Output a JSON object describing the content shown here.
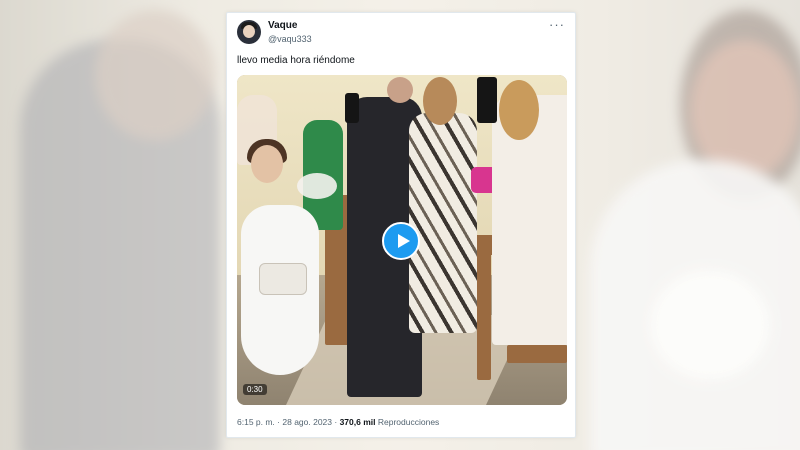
{
  "tweet": {
    "author_name": "Vaque",
    "author_handle": "@vaqu333",
    "text": "llevo media hora riéndome",
    "more_icon": "more-horizontal-icon",
    "media": {
      "type": "video",
      "duration": "0:30",
      "play_icon": "play-icon",
      "accent_color": "#1d9bf0"
    },
    "meta": {
      "time": "6:15 p. m.",
      "separator1": " · ",
      "date": "28 ago. 2023",
      "separator2": " · ",
      "views_count": "370,6 mil",
      "views_label": "Reproducciones"
    }
  }
}
